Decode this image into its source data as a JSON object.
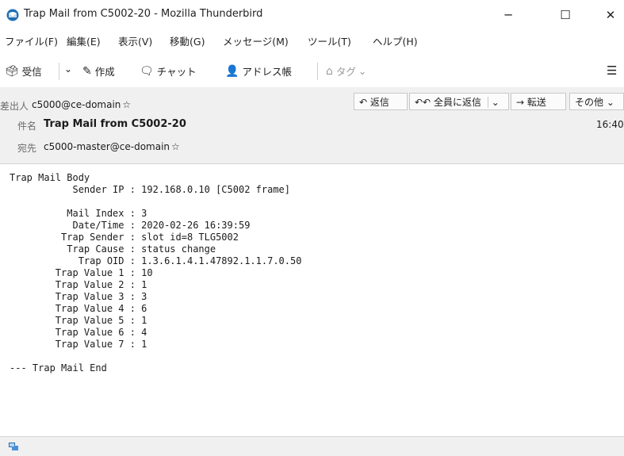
{
  "window": {
    "title": "Trap Mail from C5002-20 - Mozilla Thunderbird",
    "minimize": "─",
    "maximize": "☐",
    "close": "✕"
  },
  "menu": [
    {
      "label": "ファイル(F)"
    },
    {
      "label": "編集(E)"
    },
    {
      "label": "表示(V)"
    },
    {
      "label": "移動(G)"
    },
    {
      "label": "メッセージ(M)"
    },
    {
      "label": "ツール(T)"
    },
    {
      "label": "ヘルプ(H)"
    }
  ],
  "toolbar": {
    "get_mail": "受信",
    "write": "作成",
    "chat": "チャット",
    "address_book": "アドレス帳",
    "tag": "タグ",
    "icons": {
      "get_mail": "inbox-download-icon",
      "write": "pencil-icon",
      "chat": "chat-icon",
      "address_book": "address-book-icon",
      "tag": "tag-icon",
      "menu": "hamburger-menu-icon"
    }
  },
  "header": {
    "from_label": "差出人",
    "from_value": "c5000@ce-domain",
    "subject_label": "件名",
    "subject_value": "Trap Mail from C5002-20",
    "to_label": "宛先",
    "to_value": "c5000-master@ce-domain",
    "time": "16:40",
    "actions": {
      "reply": "返信",
      "reply_all": "全員に返信",
      "forward": "転送",
      "more": "その他"
    }
  },
  "message_body": "Trap Mail Body\n           Sender IP : 192.168.0.10 [C5002 frame]\n\n          Mail Index : 3\n           Date/Time : 2020-02-26 16:39:59\n         Trap Sender : slot id=8 TLG5002\n          Trap Cause : status change\n            Trap OID : 1.3.6.1.4.1.47892.1.1.7.0.50\n        Trap Value 1 : 10\n        Trap Value 2 : 1\n        Trap Value 3 : 3\n        Trap Value 4 : 6\n        Trap Value 5 : 1\n        Trap Value 6 : 4\n        Trap Value 7 : 1\n\n--- Trap Mail End",
  "colors": {
    "header_bg": "#f0f0f0",
    "accent": "#1f6fb5"
  }
}
